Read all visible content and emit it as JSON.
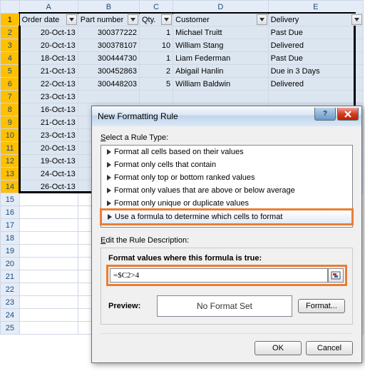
{
  "columns": [
    "A",
    "B",
    "C",
    "D",
    "E"
  ],
  "header": {
    "A": "Order date",
    "B": "Part number",
    "C": "Qty.",
    "D": "Customer",
    "E": "Delivery"
  },
  "rows": [
    {
      "n": 1
    },
    {
      "n": 2,
      "A": "20-Oct-13",
      "B": "300377222",
      "C": "1",
      "D": "Michael Truitt",
      "E": "Past Due"
    },
    {
      "n": 3,
      "A": "20-Oct-13",
      "B": "300378107",
      "C": "10",
      "D": "William Stang",
      "E": "Delivered"
    },
    {
      "n": 4,
      "A": "18-Oct-13",
      "B": "300444730",
      "C": "1",
      "D": "Liam Federman",
      "E": "Past Due"
    },
    {
      "n": 5,
      "A": "21-Oct-13",
      "B": "300452863",
      "C": "2",
      "D": "Abigail Hanlin",
      "E": "Due in 3 Days"
    },
    {
      "n": 6,
      "A": "22-Oct-13",
      "B": "300448203",
      "C": "5",
      "D": "William Baldwin",
      "E": "Delivered"
    },
    {
      "n": 7,
      "A": "23-Oct-13"
    },
    {
      "n": 8,
      "A": "16-Oct-13"
    },
    {
      "n": 9,
      "A": "21-Oct-13"
    },
    {
      "n": 10,
      "A": "23-Oct-13"
    },
    {
      "n": 11,
      "A": "20-Oct-13"
    },
    {
      "n": 12,
      "A": "19-Oct-13"
    },
    {
      "n": 13,
      "A": "24-Oct-13"
    },
    {
      "n": 14,
      "A": "26-Oct-13"
    },
    {
      "n": 15
    },
    {
      "n": 16
    },
    {
      "n": 17
    },
    {
      "n": 18
    },
    {
      "n": 19
    },
    {
      "n": 20
    },
    {
      "n": 21
    },
    {
      "n": 22
    },
    {
      "n": 23
    },
    {
      "n": 24
    },
    {
      "n": 25
    }
  ],
  "dialog": {
    "title": "New Formatting Rule",
    "select_label": "Select a Rule Type:",
    "rules": [
      "Format all cells based on their values",
      "Format only cells that contain",
      "Format only top or bottom ranked values",
      "Format only values that are above or below average",
      "Format only unique or duplicate values",
      "Use a formula to determine which cells to format"
    ],
    "edit_label": "Edit the Rule Description:",
    "formula_label": "Format values where this formula is true:",
    "formula_value": "=$C2>4",
    "preview_label": "Preview:",
    "preview_value": "No Format Set",
    "format_btn": "Format...",
    "ok": "OK",
    "cancel": "Cancel"
  }
}
